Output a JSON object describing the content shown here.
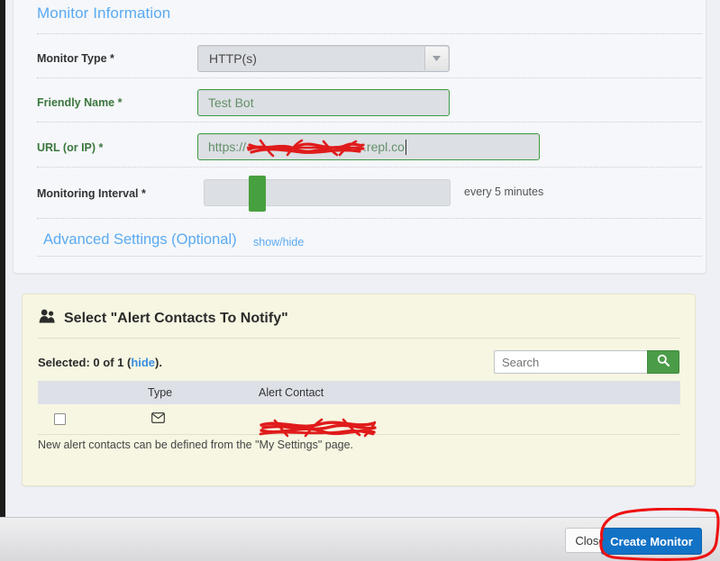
{
  "monitor_section": {
    "title": "Monitor Information",
    "fields": [
      {
        "label": "Monitor Type *",
        "type": "select",
        "value": "HTTP(s)",
        "valid": false
      },
      {
        "label": "Friendly Name *",
        "type": "text",
        "value": "Test Bot",
        "valid": true
      },
      {
        "label": "URL (or IP) *",
        "type": "url",
        "value_prefix": "https://",
        "value_redacted": "[redacted]",
        "value_suffix": ".repl.co",
        "valid": true
      },
      {
        "label": "Monitoring Interval *",
        "type": "slider",
        "value": "every 5 minutes",
        "valid": false
      }
    ],
    "advanced": {
      "label": "Advanced Settings (Optional)",
      "toggle": "show/hide"
    }
  },
  "alerts_section": {
    "icon": "people-icon",
    "title": "Select \"Alert Contacts To Notify\"",
    "selected_prefix": "Selected: 0 of 1 (",
    "selected_link": "hide",
    "selected_suffix": ").",
    "search": {
      "placeholder": "Search",
      "value": "",
      "button_icon": "search-icon"
    },
    "table": {
      "columns": [
        "",
        "Type",
        "Alert Contact"
      ],
      "rows": [
        {
          "checked": false,
          "type_icon": "envelope-icon",
          "contact": "[redacted]"
        }
      ]
    },
    "note": "New alert contacts can be defined from the \"My Settings\" page."
  },
  "footer": {
    "close_label": "Close",
    "create_label": "Create Monitor"
  },
  "colors": {
    "section_title": "#5aaaf2",
    "valid_label": "#3c763d",
    "slider_handle": "#47a03f",
    "search_button": "#4b9c49",
    "primary_button": "#1272c6",
    "alerts_panel": "#f7f6e2",
    "annotation": "#ee1111",
    "redaction": "#e01b1b"
  }
}
